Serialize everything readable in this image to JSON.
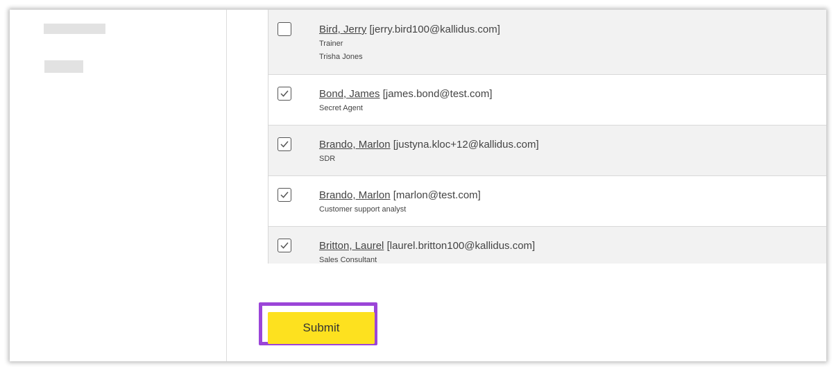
{
  "users": [
    {
      "name": "Bird, Jerry",
      "email": "[jerry.bird100@kallidus.com]",
      "details": [
        "Trainer",
        "Trisha Jones"
      ],
      "checked": false
    },
    {
      "name": "Bond, James",
      "email": "[james.bond@test.com]",
      "details": [
        "Secret Agent"
      ],
      "checked": true
    },
    {
      "name": "Brando, Marlon",
      "email": "[justyna.kloc+12@kallidus.com]",
      "details": [
        "SDR"
      ],
      "checked": true
    },
    {
      "name": "Brando, Marlon",
      "email": "[marlon@test.com]",
      "details": [
        "Customer support analyst"
      ],
      "checked": true
    },
    {
      "name": "Britton, Laurel",
      "email": "[laurel.britton100@kallidus.com]",
      "details": [
        "Sales Consultant"
      ],
      "checked": true
    }
  ],
  "actions": {
    "submit_label": "Submit"
  },
  "colors": {
    "submit_background": "#fde11f",
    "highlight_border": "#9b45d8",
    "row_alt": "#f2f2f2"
  }
}
